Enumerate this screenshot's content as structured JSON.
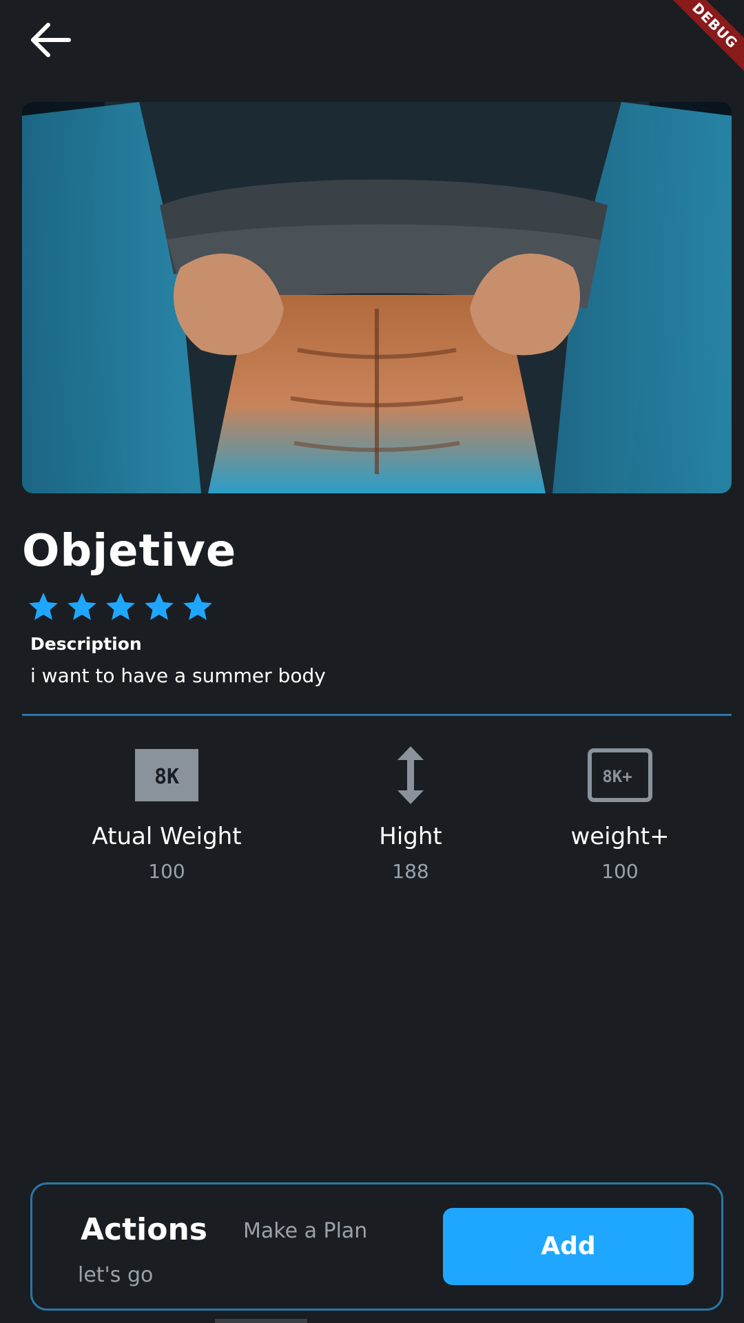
{
  "debug_banner": "DEBUG",
  "hero": {
    "image_icon": "abs-photo"
  },
  "objective": {
    "title": "Objetive",
    "rating": 5,
    "rating_max": 5,
    "description_label": "Description",
    "description_text": "i want to have a summer body"
  },
  "stats": [
    {
      "icon": "weight-8k-icon",
      "label": "Atual Weight",
      "value": "100"
    },
    {
      "icon": "height-arrow-icon",
      "label": "Hight",
      "value": "188"
    },
    {
      "icon": "weight-plus-icon",
      "label": "weight+",
      "value": "100"
    }
  ],
  "actions": {
    "title": "Actions",
    "subtitle": "Make a Plan",
    "note": "let's go",
    "button_label": "Add"
  },
  "colors": {
    "background": "#1a1e22",
    "accent": "#1fa7ff",
    "divider": "#2a77a8",
    "muted_text": "#9aa2ab",
    "icon_gray": "#8a939c",
    "debug_red": "#8a1b1b"
  }
}
